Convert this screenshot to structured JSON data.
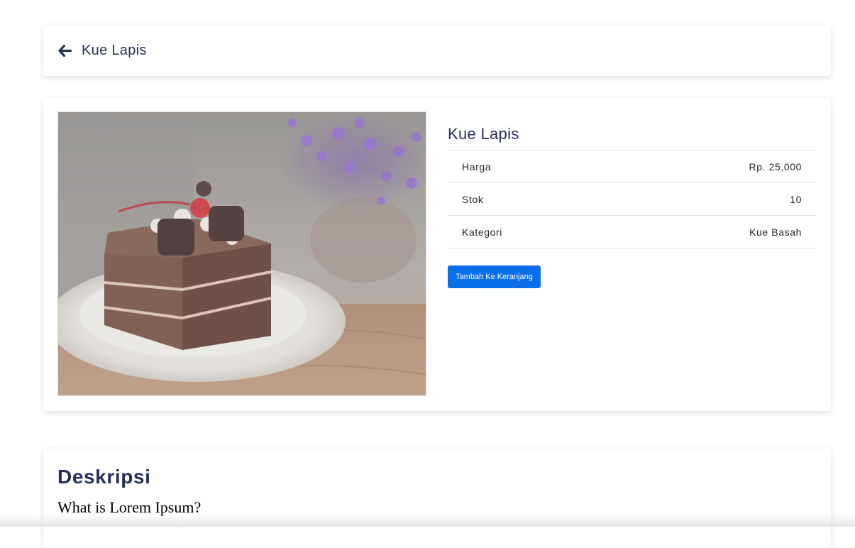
{
  "header": {
    "title": "Kue Lapis",
    "back_icon": "arrow-left-icon"
  },
  "product": {
    "name": "Kue Lapis",
    "image_subject": "chocolate-layer-cake-photo",
    "details": [
      {
        "key": "Harga",
        "value": "Rp. 25,000"
      },
      {
        "key": "Stok",
        "value": "10"
      },
      {
        "key": "Kategori",
        "value": "Kue Basah"
      }
    ],
    "add_to_cart_label": "Tambah Ke Keranjang"
  },
  "description": {
    "heading": "Deskripsi",
    "subheading": "What is Lorem Ipsum?"
  },
  "colors": {
    "text_primary": "#27305a",
    "button": "#0a6fe8"
  }
}
